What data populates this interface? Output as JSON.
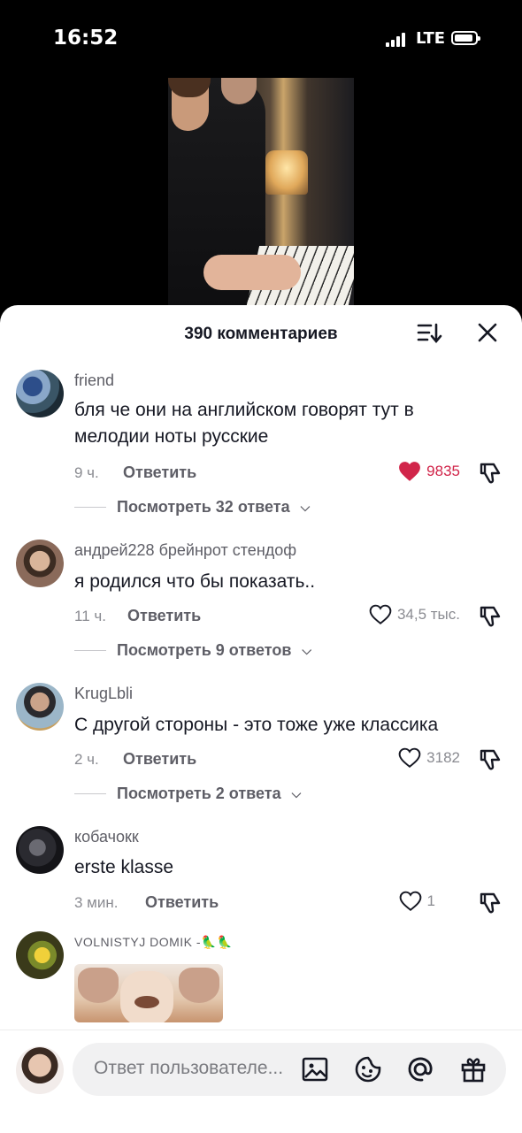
{
  "status_bar": {
    "time": "16:52",
    "network": "LTE"
  },
  "sheet": {
    "title": "390 комментариев",
    "sort_icon": "sort-icon",
    "close_icon": "close-icon"
  },
  "comments": [
    {
      "username": "friend",
      "text": "бля че они на английском говорят тут в мелодии ноты русские",
      "time": "9 ч.",
      "reply": "Ответить",
      "likes": "9835",
      "liked": true,
      "view_replies": "Посмотреть 32 ответа"
    },
    {
      "username": "андрей228 брейнрот стендоф",
      "text": "я родился что бы показать..",
      "time": "11 ч.",
      "reply": "Ответить",
      "likes": "34,5 тыс.",
      "liked": false,
      "view_replies": "Посмотреть 9 ответов"
    },
    {
      "username": "KrugLbli",
      "text": "С другой стороны - это тоже уже классика",
      "time": "2 ч.",
      "reply": "Ответить",
      "likes": "3182",
      "liked": false,
      "view_replies": "Посмотреть 2 ответа"
    },
    {
      "username": "кобачокк",
      "text": "erste klasse",
      "time": "3 мин.",
      "reply": "Ответить",
      "likes": "1",
      "liked": false
    },
    {
      "username": "VOLNISTYJ DOMIK -🦜🦜"
    }
  ],
  "bottom_bar": {
    "placeholder": "Ответ пользователе...",
    "icons": [
      "image-icon",
      "emoji-icon",
      "mention-icon",
      "gift-icon"
    ]
  },
  "colors": {
    "liked": "#d1254a",
    "muted": "#8a8b91",
    "text": "#161823"
  }
}
